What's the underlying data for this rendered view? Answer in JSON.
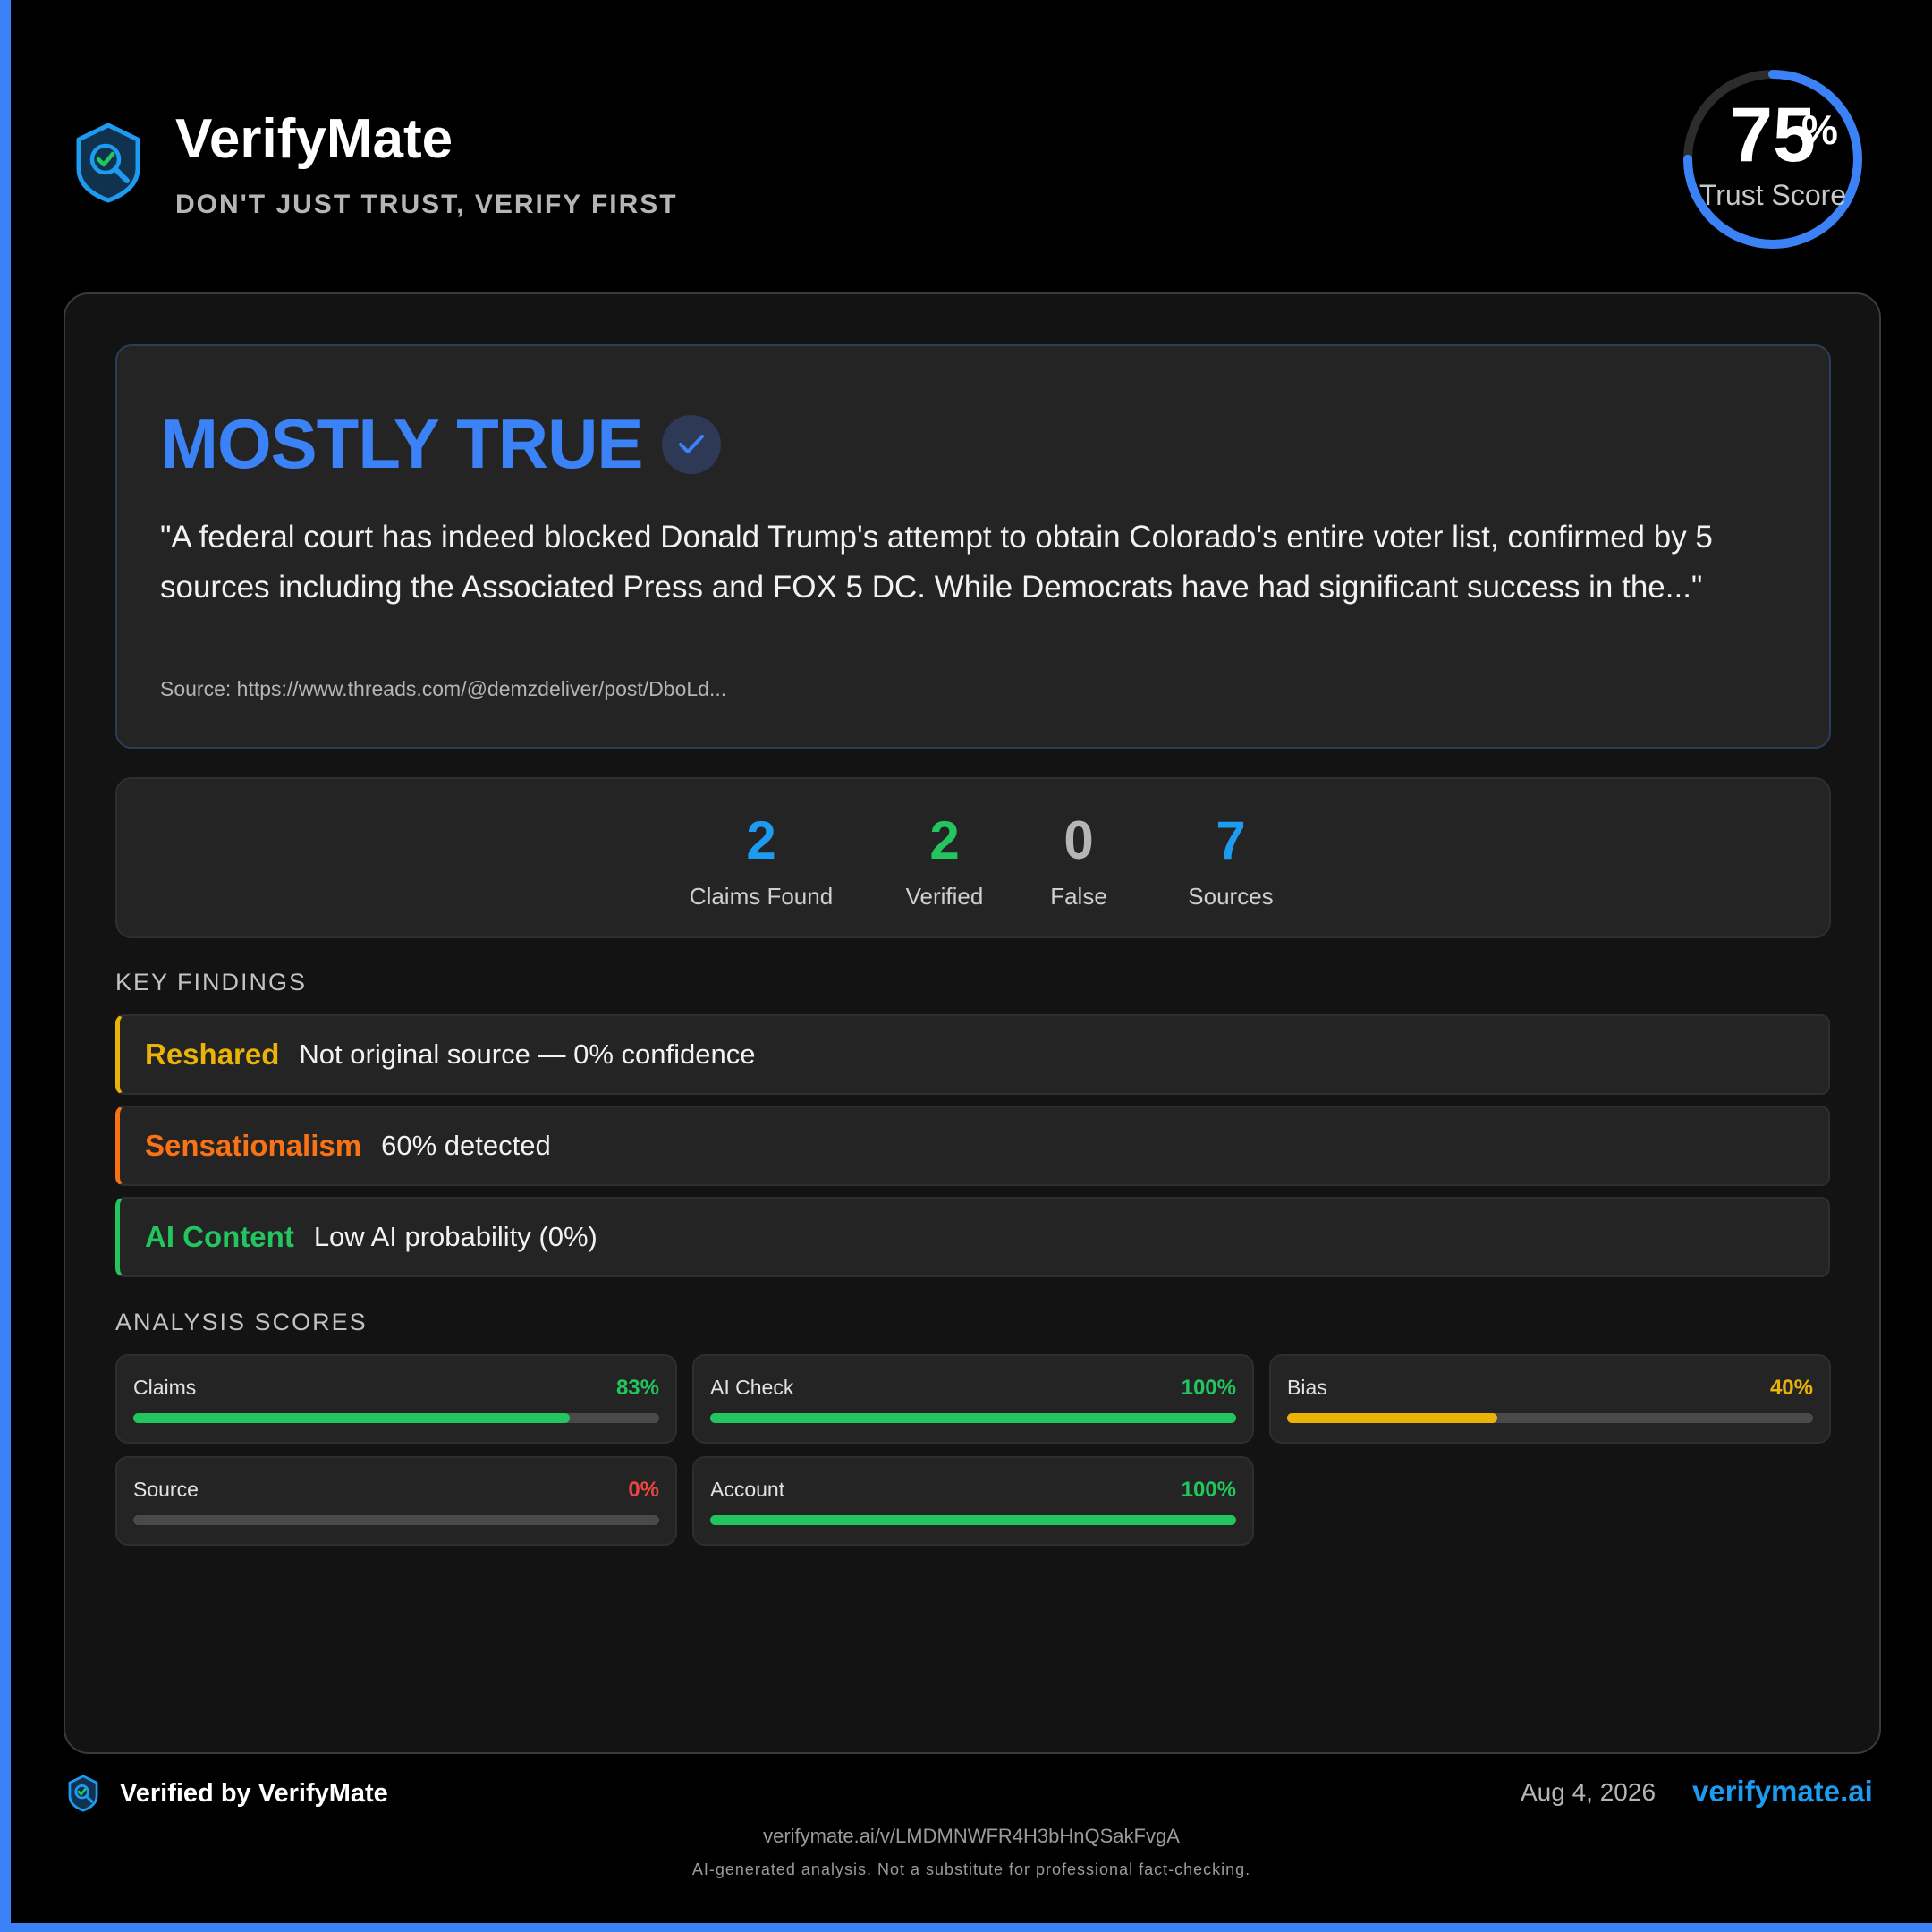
{
  "brand": {
    "name": "VerifyMate",
    "tagline": "DON'T JUST TRUST, VERIFY FIRST",
    "logo_icon": "shield-magnifier-check-icon"
  },
  "trust_score": {
    "value": "75",
    "unit": "%",
    "label": "Trust Score",
    "fraction": 0.75,
    "color": "#3b82f6"
  },
  "verdict": {
    "label": "MOSTLY TRUE",
    "badge_icon": "check-icon",
    "color": "#3b82f6",
    "quote": "\"A federal court has indeed blocked Donald Trump's attempt to obtain Colorado's entire voter list, confirmed by 5 sources including the Associated Press and FOX 5 DC. While Democrats have had significant success in the...\"",
    "source": "Source: https://www.threads.com/@demzdeliver/post/DboLd..."
  },
  "stats": [
    {
      "value": "2",
      "label": "Claims Found",
      "color": "#1d9bf0"
    },
    {
      "value": "2",
      "label": "Verified",
      "color": "#22c55e"
    },
    {
      "value": "0",
      "label": "False",
      "color": "#b5b5b5"
    },
    {
      "value": "7",
      "label": "Sources",
      "color": "#1d9bf0"
    }
  ],
  "key_findings": {
    "title": "KEY FINDINGS",
    "items": [
      {
        "tag": "Reshared",
        "text": "Not original source — 0% confidence",
        "color": "#eab308"
      },
      {
        "tag": "Sensationalism",
        "text": "60% detected",
        "color": "#f97316"
      },
      {
        "tag": "AI Content",
        "text": "Low AI probability (0%)",
        "color": "#22c55e"
      }
    ]
  },
  "analysis_scores": {
    "title": "ANALYSIS SCORES",
    "items": [
      {
        "label": "Claims",
        "value": "83%",
        "fraction": 0.83,
        "color": "#22c55e"
      },
      {
        "label": "AI Check",
        "value": "100%",
        "fraction": 1.0,
        "color": "#22c55e"
      },
      {
        "label": "Bias",
        "value": "40%",
        "fraction": 0.4,
        "color": "#eab308"
      },
      {
        "label": "Source",
        "value": "0%",
        "fraction": 0.0,
        "color": "#ef4444"
      },
      {
        "label": "Account",
        "value": "100%",
        "fraction": 1.0,
        "color": "#22c55e"
      }
    ]
  },
  "footer": {
    "verified_by": "Verified by VerifyMate",
    "date": "Aug 4, 2026",
    "site": "verifymate.ai",
    "share_url": "verifymate.ai/v/LMDMNWFR4H3bHnQSakFvgA",
    "disclaimer": "AI-generated analysis. Not a substitute for professional fact-checking."
  }
}
